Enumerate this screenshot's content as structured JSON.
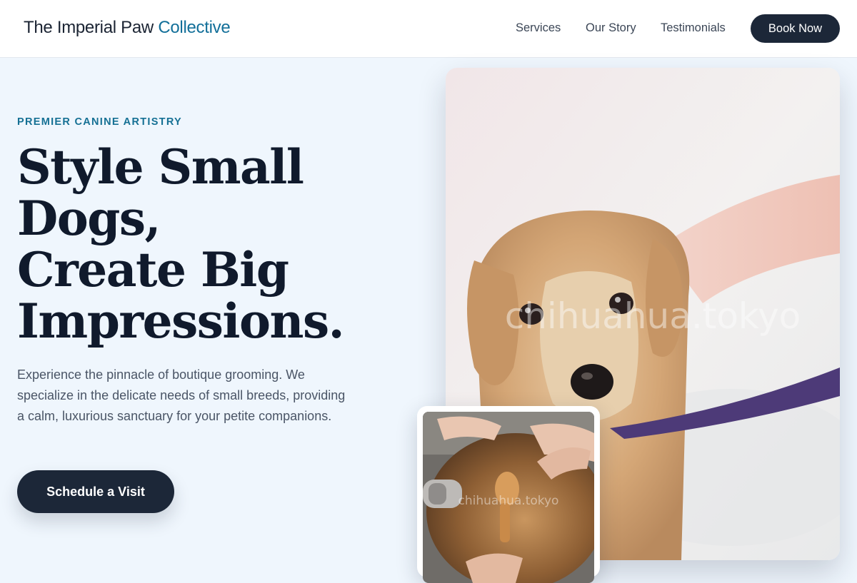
{
  "header": {
    "brand_main": "The Imperial Paw",
    "brand_accent": "Collective",
    "nav": {
      "services": "Services",
      "our_story": "Our Story",
      "testimonials": "Testimonials"
    },
    "book_button": "Book Now"
  },
  "hero": {
    "eyebrow": "PREMIER CANINE ARTISTRY",
    "headline_lines": [
      "Style Small",
      "Dogs,",
      "Create Big",
      "Impressions."
    ],
    "lede": "Experience the pinnacle of boutique grooming. We specialize in the delicate needs of small breeds, providing a calm, luxurious sanctuary for your petite companions.",
    "cta": "Schedule a Visit"
  },
  "images": {
    "main_watermark": "chihuahua.tokyo",
    "inset_watermark": "chihuahua.tokyo"
  },
  "colors": {
    "accent": "#126f99",
    "dark_button": "#1c2738",
    "page_background": "#eff6fd"
  }
}
